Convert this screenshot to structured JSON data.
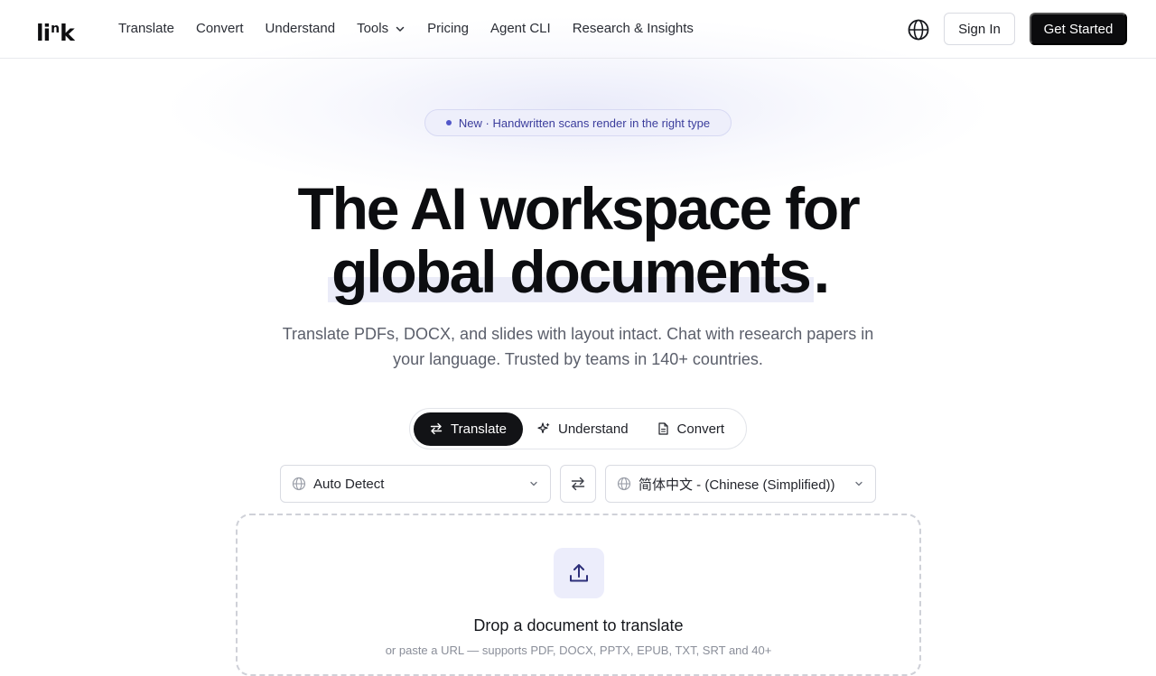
{
  "header": {
    "logo": {
      "left": "li",
      "sup": "n",
      "right": "k"
    },
    "nav": [
      "Translate",
      "Convert",
      "Understand",
      "Tools",
      "Pricing",
      "Agent CLI",
      "Research & Insights"
    ],
    "tools_icon": "chevron-down-icon",
    "language_icon": "globe-icon",
    "sign_in": "Sign In",
    "get_started": "Get Started"
  },
  "badge": {
    "text": "New · Handwritten scans render in the right type",
    "dot_color": "#5257c9"
  },
  "hero": {
    "line1": "The AI workspace for",
    "line2_highlight": "global documents",
    "line2_suffix": ".",
    "subtitle": "Translate PDFs, DOCX, and slides with layout intact. Chat with research papers in your language. Trusted by teams in 140+ countries."
  },
  "modes": {
    "active": "Translate",
    "tabs": [
      {
        "label": "Translate",
        "icon": "swap-arrows-icon"
      },
      {
        "label": "Understand",
        "icon": "sparkle-icon"
      },
      {
        "label": "Convert",
        "icon": "document-icon"
      }
    ]
  },
  "language": {
    "source": "Auto Detect",
    "target": "简体中文 - (Chinese (Simplified))",
    "swap_icon": "swap-arrows-icon"
  },
  "dropzone": {
    "title": "Drop a document to translate",
    "subtitle": "or paste a URL — supports PDF, DOCX, PPTX, EPUB, TXT, SRT and 40+",
    "icon": "upload-icon"
  },
  "colors": {
    "accent": "#5257c9",
    "primary": "#0b0b0d",
    "badge_bg": "#eeeffb",
    "highlight": "#ebecf8"
  }
}
